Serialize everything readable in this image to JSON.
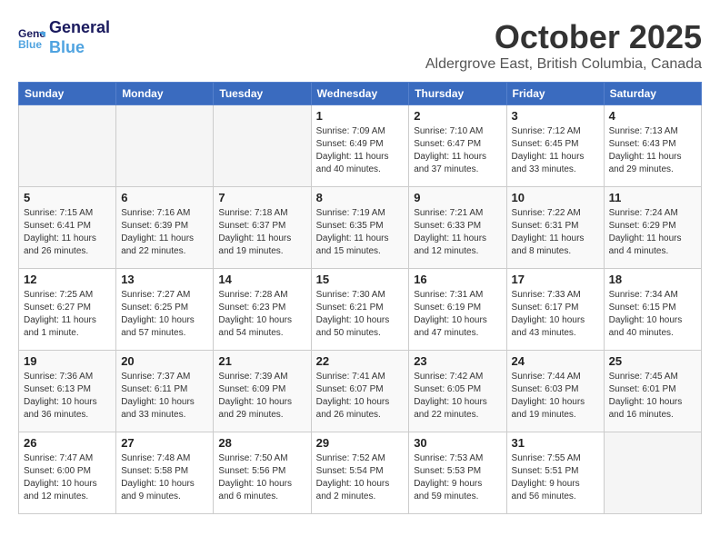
{
  "logo": {
    "line1": "General",
    "line2": "Blue"
  },
  "title": "October 2025",
  "location": "Aldergrove East, British Columbia, Canada",
  "headers": [
    "Sunday",
    "Monday",
    "Tuesday",
    "Wednesday",
    "Thursday",
    "Friday",
    "Saturday"
  ],
  "weeks": [
    [
      {
        "day": "",
        "info": ""
      },
      {
        "day": "",
        "info": ""
      },
      {
        "day": "",
        "info": ""
      },
      {
        "day": "1",
        "info": "Sunrise: 7:09 AM\nSunset: 6:49 PM\nDaylight: 11 hours\nand 40 minutes."
      },
      {
        "day": "2",
        "info": "Sunrise: 7:10 AM\nSunset: 6:47 PM\nDaylight: 11 hours\nand 37 minutes."
      },
      {
        "day": "3",
        "info": "Sunrise: 7:12 AM\nSunset: 6:45 PM\nDaylight: 11 hours\nand 33 minutes."
      },
      {
        "day": "4",
        "info": "Sunrise: 7:13 AM\nSunset: 6:43 PM\nDaylight: 11 hours\nand 29 minutes."
      }
    ],
    [
      {
        "day": "5",
        "info": "Sunrise: 7:15 AM\nSunset: 6:41 PM\nDaylight: 11 hours\nand 26 minutes."
      },
      {
        "day": "6",
        "info": "Sunrise: 7:16 AM\nSunset: 6:39 PM\nDaylight: 11 hours\nand 22 minutes."
      },
      {
        "day": "7",
        "info": "Sunrise: 7:18 AM\nSunset: 6:37 PM\nDaylight: 11 hours\nand 19 minutes."
      },
      {
        "day": "8",
        "info": "Sunrise: 7:19 AM\nSunset: 6:35 PM\nDaylight: 11 hours\nand 15 minutes."
      },
      {
        "day": "9",
        "info": "Sunrise: 7:21 AM\nSunset: 6:33 PM\nDaylight: 11 hours\nand 12 minutes."
      },
      {
        "day": "10",
        "info": "Sunrise: 7:22 AM\nSunset: 6:31 PM\nDaylight: 11 hours\nand 8 minutes."
      },
      {
        "day": "11",
        "info": "Sunrise: 7:24 AM\nSunset: 6:29 PM\nDaylight: 11 hours\nand 4 minutes."
      }
    ],
    [
      {
        "day": "12",
        "info": "Sunrise: 7:25 AM\nSunset: 6:27 PM\nDaylight: 11 hours\nand 1 minute."
      },
      {
        "day": "13",
        "info": "Sunrise: 7:27 AM\nSunset: 6:25 PM\nDaylight: 10 hours\nand 57 minutes."
      },
      {
        "day": "14",
        "info": "Sunrise: 7:28 AM\nSunset: 6:23 PM\nDaylight: 10 hours\nand 54 minutes."
      },
      {
        "day": "15",
        "info": "Sunrise: 7:30 AM\nSunset: 6:21 PM\nDaylight: 10 hours\nand 50 minutes."
      },
      {
        "day": "16",
        "info": "Sunrise: 7:31 AM\nSunset: 6:19 PM\nDaylight: 10 hours\nand 47 minutes."
      },
      {
        "day": "17",
        "info": "Sunrise: 7:33 AM\nSunset: 6:17 PM\nDaylight: 10 hours\nand 43 minutes."
      },
      {
        "day": "18",
        "info": "Sunrise: 7:34 AM\nSunset: 6:15 PM\nDaylight: 10 hours\nand 40 minutes."
      }
    ],
    [
      {
        "day": "19",
        "info": "Sunrise: 7:36 AM\nSunset: 6:13 PM\nDaylight: 10 hours\nand 36 minutes."
      },
      {
        "day": "20",
        "info": "Sunrise: 7:37 AM\nSunset: 6:11 PM\nDaylight: 10 hours\nand 33 minutes."
      },
      {
        "day": "21",
        "info": "Sunrise: 7:39 AM\nSunset: 6:09 PM\nDaylight: 10 hours\nand 29 minutes."
      },
      {
        "day": "22",
        "info": "Sunrise: 7:41 AM\nSunset: 6:07 PM\nDaylight: 10 hours\nand 26 minutes."
      },
      {
        "day": "23",
        "info": "Sunrise: 7:42 AM\nSunset: 6:05 PM\nDaylight: 10 hours\nand 22 minutes."
      },
      {
        "day": "24",
        "info": "Sunrise: 7:44 AM\nSunset: 6:03 PM\nDaylight: 10 hours\nand 19 minutes."
      },
      {
        "day": "25",
        "info": "Sunrise: 7:45 AM\nSunset: 6:01 PM\nDaylight: 10 hours\nand 16 minutes."
      }
    ],
    [
      {
        "day": "26",
        "info": "Sunrise: 7:47 AM\nSunset: 6:00 PM\nDaylight: 10 hours\nand 12 minutes."
      },
      {
        "day": "27",
        "info": "Sunrise: 7:48 AM\nSunset: 5:58 PM\nDaylight: 10 hours\nand 9 minutes."
      },
      {
        "day": "28",
        "info": "Sunrise: 7:50 AM\nSunset: 5:56 PM\nDaylight: 10 hours\nand 6 minutes."
      },
      {
        "day": "29",
        "info": "Sunrise: 7:52 AM\nSunset: 5:54 PM\nDaylight: 10 hours\nand 2 minutes."
      },
      {
        "day": "30",
        "info": "Sunrise: 7:53 AM\nSunset: 5:53 PM\nDaylight: 9 hours\nand 59 minutes."
      },
      {
        "day": "31",
        "info": "Sunrise: 7:55 AM\nSunset: 5:51 PM\nDaylight: 9 hours\nand 56 minutes."
      },
      {
        "day": "",
        "info": ""
      }
    ]
  ]
}
